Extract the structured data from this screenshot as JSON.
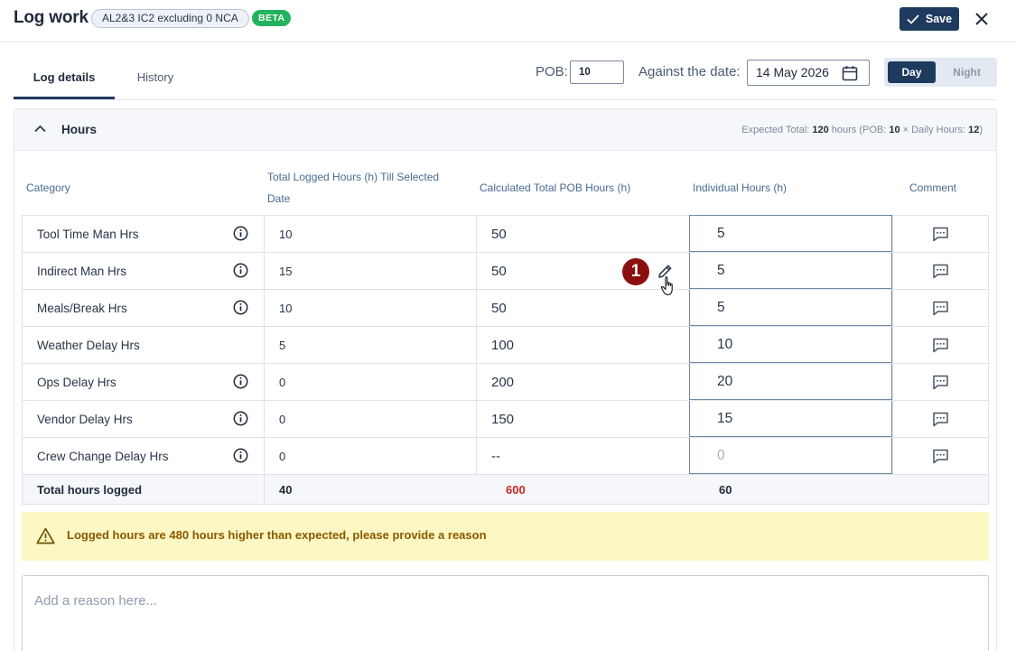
{
  "header": {
    "title": "Log work",
    "tag": "AL2&3 IC2 excluding 0 NCA",
    "beta": "BETA",
    "save_label": "Save"
  },
  "tabs": [
    {
      "label": "Log details",
      "active": true
    },
    {
      "label": "History",
      "active": false
    }
  ],
  "controls": {
    "pob_label": "POB:",
    "pob_value": "10",
    "date_label": "Against the date:",
    "date_value": "14 May 2026",
    "shift_day": "Day",
    "shift_night": "Night",
    "active_shift": "Day"
  },
  "hours": {
    "title": "Hours",
    "expected": {
      "prefix": "Expected Total: ",
      "total": "120",
      "mid": " hours (POB: ",
      "pob": "10",
      "mid2": " × Daily Hours: ",
      "daily": "12",
      "suffix": ")"
    },
    "columns": {
      "category": "Category",
      "total_logged": "Total Logged Hours (h) Till Selected Date",
      "calc_pob": "Calculated Total POB Hours (h)",
      "individual": "Individual Hours (h)",
      "comment": "Comment"
    },
    "rows": [
      {
        "category": "Tool Time Man Hrs",
        "info": true,
        "total": "10",
        "pob": "50",
        "individual": "5"
      },
      {
        "category": "Indirect Man Hrs",
        "info": true,
        "total": "15",
        "pob": "50",
        "individual": "5"
      },
      {
        "category": "Meals/Break Hrs",
        "info": true,
        "total": "10",
        "pob": "50",
        "individual": "5"
      },
      {
        "category": "Weather Delay Hrs",
        "info": false,
        "total": "5",
        "pob": "100",
        "individual": "10"
      },
      {
        "category": "Ops Delay Hrs",
        "info": true,
        "total": "0",
        "pob": "200",
        "individual": "20"
      },
      {
        "category": "Vendor Delay Hrs",
        "info": true,
        "total": "0",
        "pob": "150",
        "individual": "15"
      },
      {
        "category": "Crew Change Delay Hrs",
        "info": true,
        "total": "0",
        "pob": "--",
        "individual": "",
        "individual_placeholder": "0"
      }
    ],
    "totals": {
      "label": "Total hours logged",
      "total": "40",
      "pob": "600",
      "individual": "60"
    }
  },
  "annotation": {
    "step": "1"
  },
  "warning": {
    "text": "Logged hours are 480 hours higher than expected, please provide a reason"
  },
  "reason": {
    "placeholder": "Add a reason here..."
  },
  "colors": {
    "primary": "#1e3a5f",
    "beta": "#22b35c",
    "over_total": "#c62828",
    "warning_bg": "#fdf7c3",
    "warning_text": "#8a5a00",
    "annotation": "#8b0f0f"
  }
}
